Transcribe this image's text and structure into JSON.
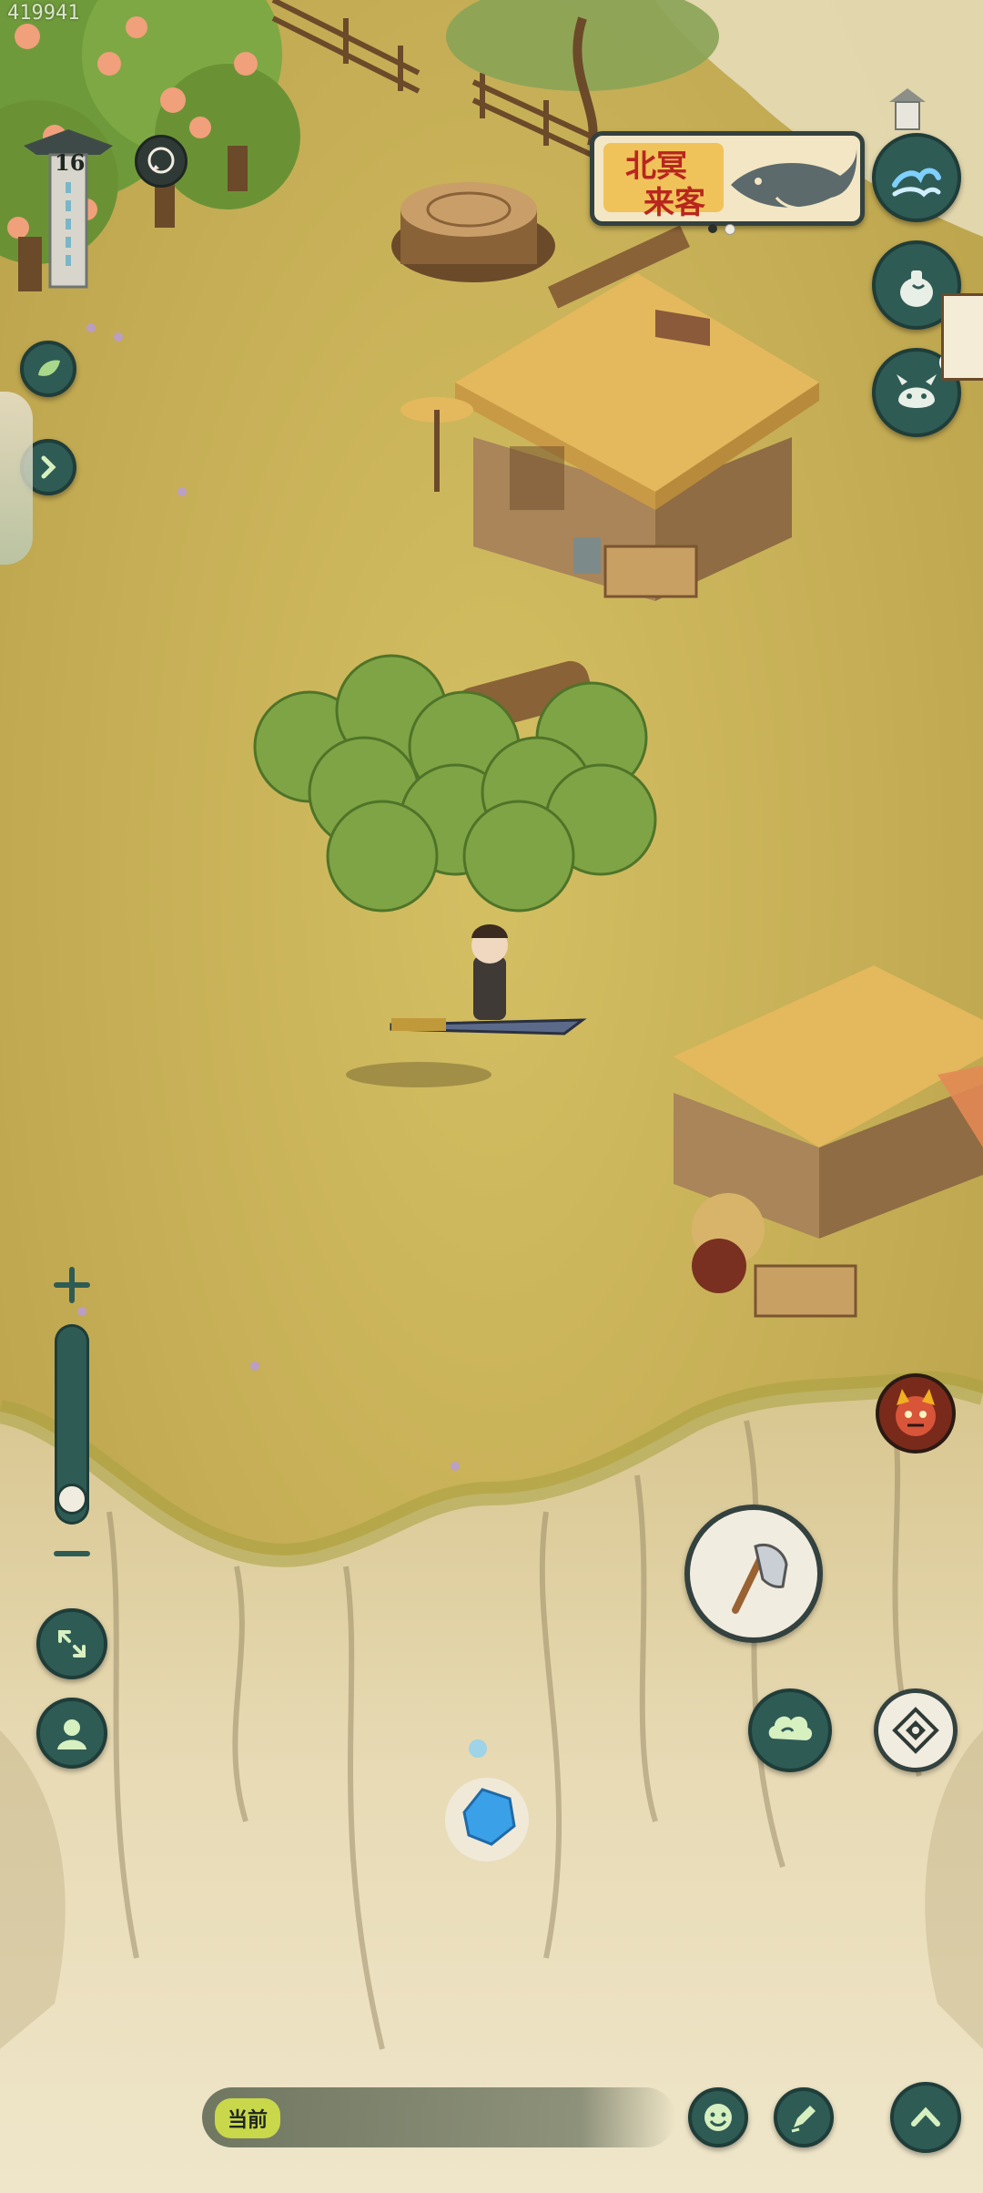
{
  "overlay_counter": "419941",
  "level_marker": {
    "value": "16"
  },
  "event_banner": {
    "line1": "北冥",
    "line2": "来客"
  },
  "bottom_bar": {
    "current_label": "当前"
  },
  "zoom": {
    "level": 0.05
  },
  "colors": {
    "grass": "#c9b25a",
    "cliff": "#e2d2a8",
    "button_dark": "#2f5b55",
    "button_light": "#f1ece0",
    "banner_red": "#b8261e"
  },
  "icons": {
    "left": [
      "leaf-icon",
      "chevron-right-icon",
      "expand-icon",
      "portrait-icon"
    ],
    "right": [
      "wave-icon",
      "gourd-icon",
      "monster-icon",
      "demon-icon",
      "axe-icon",
      "cloud-icon",
      "compass-icon"
    ],
    "bottom": [
      "smile-icon",
      "brush-icon",
      "chevron-up-icon"
    ]
  }
}
